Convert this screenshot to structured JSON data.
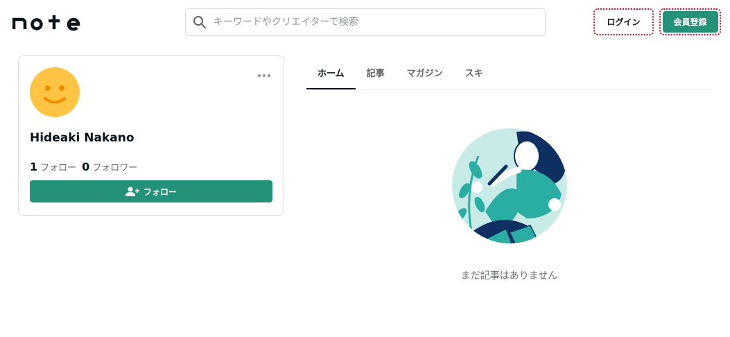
{
  "header": {
    "logo_text": "note",
    "search": {
      "placeholder": "キーワードやクリエイターで検索",
      "value": ""
    },
    "login_label": "ログイン",
    "signup_label": "会員登録"
  },
  "profile": {
    "name": "Hideaki Nakano",
    "following_count": "1",
    "following_label": "フォロー",
    "followers_count": "0",
    "followers_label": "フォロワー",
    "follow_button_label": "フォロー"
  },
  "tabs": [
    {
      "label": "ホーム",
      "active": true
    },
    {
      "label": "記事"
    },
    {
      "label": "マガジン"
    },
    {
      "label": "スキ"
    }
  ],
  "empty_state": {
    "message": "まだ記事はありません"
  },
  "colors": {
    "accent": "#249279",
    "avatar": "#ffc444",
    "text": "#08131a"
  }
}
